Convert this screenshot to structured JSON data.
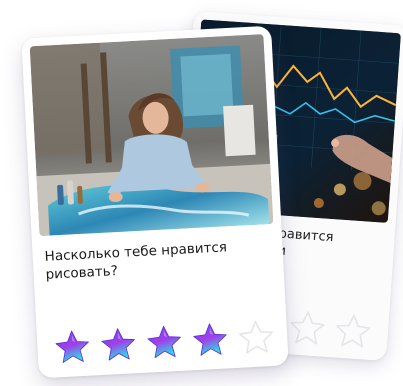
{
  "front_card": {
    "question": "Насколько тебе нравится рисовать?",
    "photo_icon": "painting-artist-photo",
    "rating": {
      "value": 4,
      "max": 5
    }
  },
  "back_card": {
    "question_visible_fragment_line1": "равится",
    "question_visible_fragment_line2": "и",
    "photo_icon": "stock-trading-chart-photo",
    "rating": {
      "value": 0,
      "max": 3
    }
  },
  "colors": {
    "star_filled_top": "#6e4bff",
    "star_filled_bottom": "#2fd6e6",
    "star_empty_stroke": "#e6e6ea"
  }
}
